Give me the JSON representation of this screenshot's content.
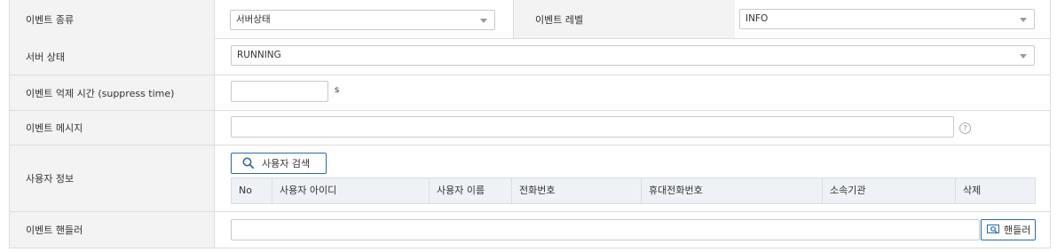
{
  "event_type": {
    "label": "이벤트 종류",
    "value": "서버상태"
  },
  "event_level": {
    "label": "이벤트 레벨",
    "value": "INFO"
  },
  "server_status": {
    "label": "서버 상태",
    "value": "RUNNING"
  },
  "suppress_time": {
    "label": "이벤트 억제 시간 (suppress time)",
    "value": "",
    "unit": "s"
  },
  "event_message": {
    "label": "이벤트 메시지",
    "value": "",
    "help_glyph": "?"
  },
  "user_info": {
    "label": "사용자 정보",
    "search_button": "사용자 검색",
    "columns": [
      "No",
      "사용자 아이디",
      "사용자 이름",
      "전화번호",
      "휴대전화번호",
      "소속기관",
      "삭제"
    ]
  },
  "event_handler": {
    "label": "이벤트 핸들러",
    "value": "",
    "button": "핸들러"
  },
  "colors": {
    "accent": "#2c6aa3",
    "label_bg": "#f3f3f3",
    "border": "#dcdcdc",
    "table_header_bg": "#eef2f7"
  }
}
